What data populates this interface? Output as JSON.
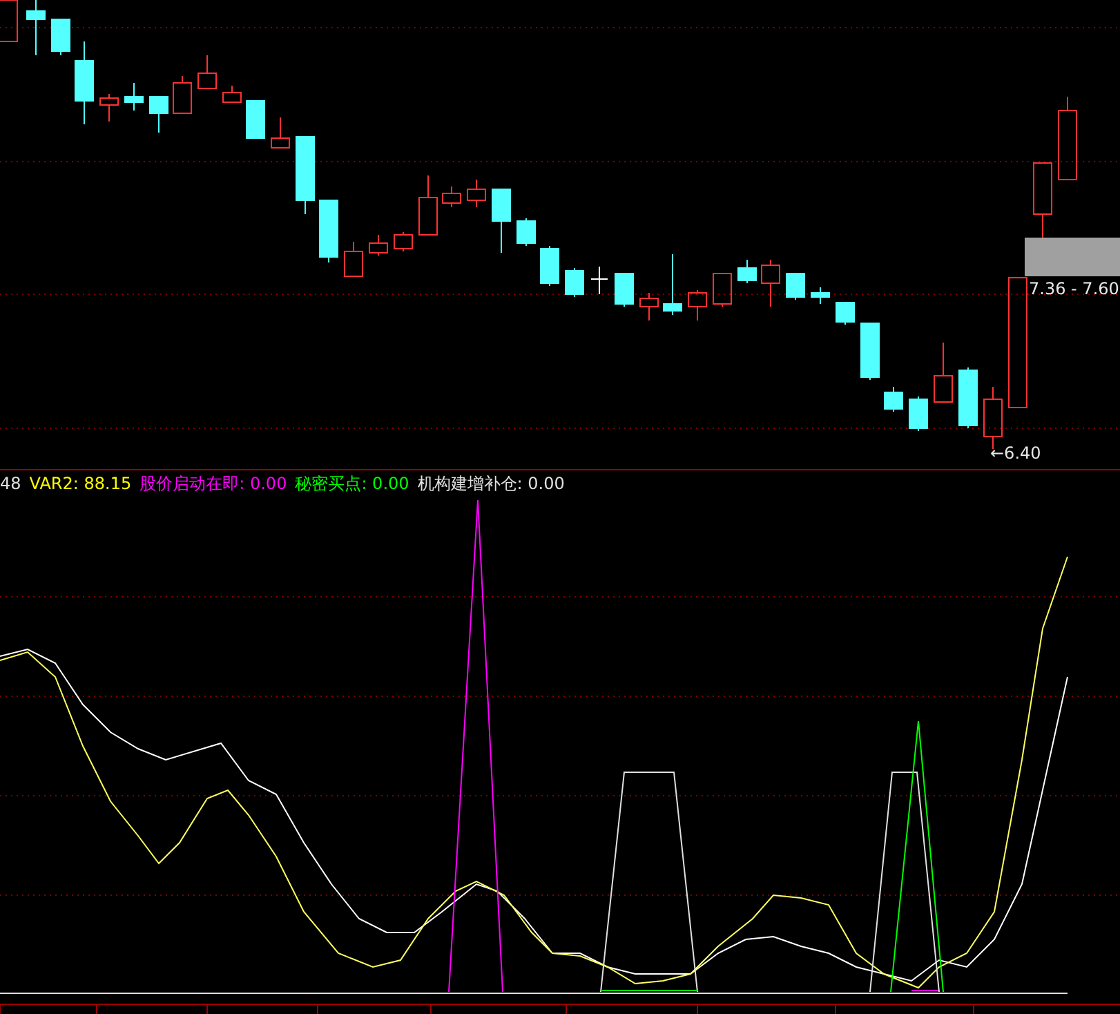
{
  "price_panel": {
    "range_label": "7.36 - 7.60",
    "low_label": "←6.40"
  },
  "indicator_panel": {
    "legend": [
      {
        "text": "48",
        "color": "#e0e0e0"
      },
      {
        "text": "VAR2: 88.15",
        "color": "#ffff00"
      },
      {
        "text": "股价启动在即: 0.00",
        "color": "#ff00ff"
      },
      {
        "text": "秘密买点: 0.00",
        "color": "#00ff00"
      },
      {
        "text": "机构建增补仓: 0.00",
        "color": "#e0e0e0"
      }
    ]
  }
}
